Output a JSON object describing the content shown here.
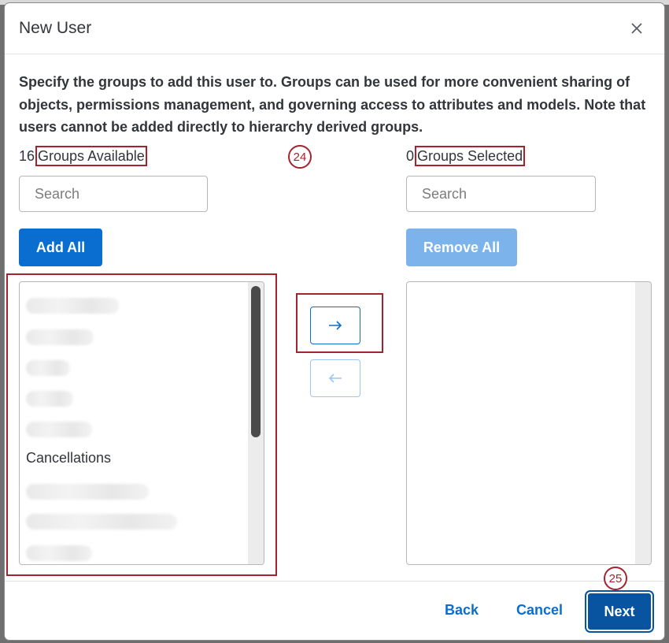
{
  "dialog": {
    "title": "New User",
    "intro": "Specify the groups to add this user to. Groups can be used for more convenient sharing of objects, permissions management, and governing access to attributes and models. Note that users cannot be added directly to hierarchy derived groups."
  },
  "available": {
    "count": "16",
    "label": "Groups Available",
    "search_placeholder": "Search",
    "add_all_label": "Add All",
    "visible_item": "Cancellations"
  },
  "selected": {
    "count": "0",
    "label": "Groups Selected",
    "search_placeholder": "Search",
    "remove_all_label": "Remove All"
  },
  "icons": {
    "close": "close-icon",
    "move_right": "arrow-right-icon",
    "move_left": "arrow-left-icon"
  },
  "callouts": {
    "step_a": "24",
    "step_b": "25"
  },
  "footer": {
    "back_label": "Back",
    "cancel_label": "Cancel",
    "next_label": "Next"
  },
  "colors": {
    "accent": "#0a6ed1",
    "primary_dark": "#0854a0",
    "annotation": "#a3242e"
  }
}
